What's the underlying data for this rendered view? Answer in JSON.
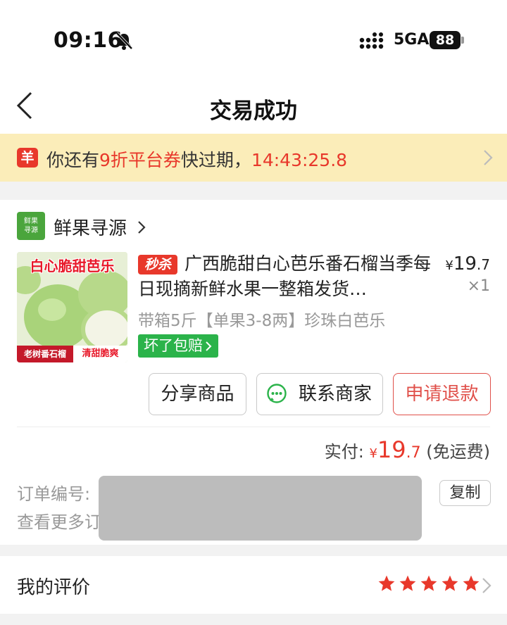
{
  "status_bar": {
    "time": "09:16",
    "network": "5GA",
    "battery": "88"
  },
  "nav": {
    "title": "交易成功"
  },
  "coupon": {
    "icon_text": "羊",
    "prefix": "你还有",
    "highlight": "9折平台券",
    "suffix": "快过期，",
    "countdown": "14:43:25.8"
  },
  "shop": {
    "logo_line1": "鲜果",
    "logo_line2": "寻源",
    "name": "鲜果寻源"
  },
  "product": {
    "image_headline": "白心脆甜芭乐",
    "image_tag_left": "老树番石榴",
    "image_tag_right": "清甜脆爽",
    "badge": "秒杀",
    "title": "广西脆甜白心芭乐番石榴当季每日现摘新鲜水果一整箱发货…",
    "price_yen": "¥",
    "price_int": "19",
    "price_dec": ".7",
    "quantity": "×1",
    "sku": "带箱5斤【单果3-8两】珍珠白芭乐",
    "guarantee": "坏了包赔"
  },
  "actions": {
    "share": "分享商品",
    "contact": "联系商家",
    "refund": "申请退款"
  },
  "payment": {
    "label": "实付: ",
    "yen": "¥",
    "amount_int": "19",
    "amount_dec": ".7",
    "note": " (免运费)"
  },
  "order_info": {
    "order_no_label": "订单编号:",
    "more_label": "查看更多订",
    "copy": "复制"
  },
  "review": {
    "label": "我的评价",
    "rating": 5,
    "max_rating": 5
  },
  "colors": {
    "accent_red": "#e8382b",
    "banner_bg": "#fbedb9",
    "guarantee_green": "#2bb34a",
    "star": "#e8382b"
  },
  "icons": {
    "bell": "bell-slash-icon",
    "signal": "signal-icon",
    "back": "chevron-left-icon",
    "chat": "chat-bubble-icon",
    "chevron": "chevron-right-icon",
    "star": "star-icon"
  }
}
